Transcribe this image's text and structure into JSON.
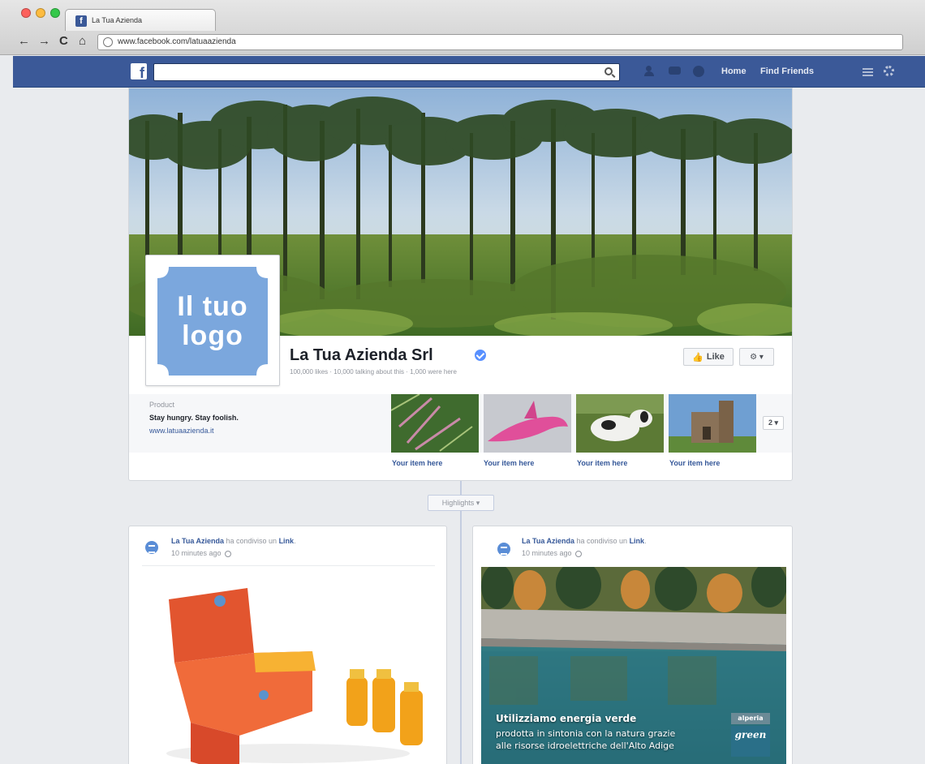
{
  "browser": {
    "tab_title": "La Tua Azienda",
    "tab_favicon": "f",
    "back_label": "←",
    "forward_label": "→",
    "reload_label": "C",
    "home_label": "⌂",
    "url": "www.facebook.com/latuaazienda"
  },
  "fb_nav": {
    "logo": "f",
    "search_placeholder": "",
    "home_label": "Home",
    "find_friends_label": "Find Friends"
  },
  "page": {
    "logo_line1": "Il tuo",
    "logo_line2": "logo",
    "name": "La Tua Azienda Srl",
    "stats": "100,000 likes · 10,000 talking about this · 1,000 were here",
    "like_label": "Like",
    "like_icon": "👍",
    "gear_label": "⚙ ▾",
    "category": "Product",
    "description": "Stay hungry. Stay foolish.",
    "website": "www.latuaazienda.it",
    "apps": [
      {
        "label": "Your item here"
      },
      {
        "label": "Your item here"
      },
      {
        "label": "Your item here"
      },
      {
        "label": "Your item here"
      }
    ],
    "more_apps_label": "2 ▾"
  },
  "timeline": {
    "highlights_label": "Highlights ▾"
  },
  "posts": [
    {
      "author": "La Tua Azienda",
      "action": " ha condiviso un ",
      "object": "Link",
      "suffix": ".",
      "time": "10 minutes ago"
    },
    {
      "author": "La Tua Azienda",
      "action": " ha condiviso un ",
      "object": "Link",
      "suffix": ".",
      "time": "10 minutes ago",
      "ad_title": "Utilizziamo energia verde",
      "ad_line1": "prodotta in sintonia con la natura grazie",
      "ad_line2": "alle risorse idroelettriche dell'Alto Adige",
      "badge_top": "alperia",
      "badge_bottom": "green"
    }
  ],
  "colors": {
    "fb_blue": "#3b5998",
    "link_blue": "#365899",
    "logo_blue": "#7ba7dd"
  }
}
